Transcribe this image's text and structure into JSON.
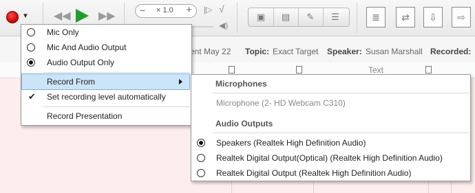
{
  "toolbar": {
    "record_icon": "record-dot-icon",
    "speed": {
      "minus": "−",
      "value": "× 1.0",
      "plus": "+"
    }
  },
  "info": {
    "event_fragment": "vent May 22",
    "topic_label": "Topic:",
    "topic_value": "Exact Target",
    "speaker_label": "Speaker:",
    "speaker_value": "Susan Marshall",
    "recorded_label": "Recorded:"
  },
  "columns": {
    "text_header": "Text"
  },
  "record_menu": {
    "items": [
      {
        "label": "Mic Only",
        "selected": false
      },
      {
        "label": "Mic And Audio Output",
        "selected": false
      },
      {
        "label": "Audio Output Only",
        "selected": true
      }
    ],
    "record_from": "Record From",
    "auto_level": "Set recording level automatically",
    "record_presentation": "Record Presentation"
  },
  "record_from_submenu": {
    "microphones_header": "Microphones",
    "microphone_device": "Microphone (2- HD Webcam C310)",
    "audio_outputs_header": "Audio Outputs",
    "outputs": [
      {
        "label": "Speakers (Realtek High Definition Audio)",
        "selected": true
      },
      {
        "label": "Realtek Digital Output(Optical) (Realtek High Definition Audio)",
        "selected": false
      },
      {
        "label": "Realtek Digital Output (Realtek High Definition Audio)",
        "selected": false
      }
    ]
  },
  "colors": {
    "highlight": "#cce4f7",
    "play": "#1e9e2a",
    "record": "#d40000",
    "doc_bg": "#fdeeee"
  }
}
